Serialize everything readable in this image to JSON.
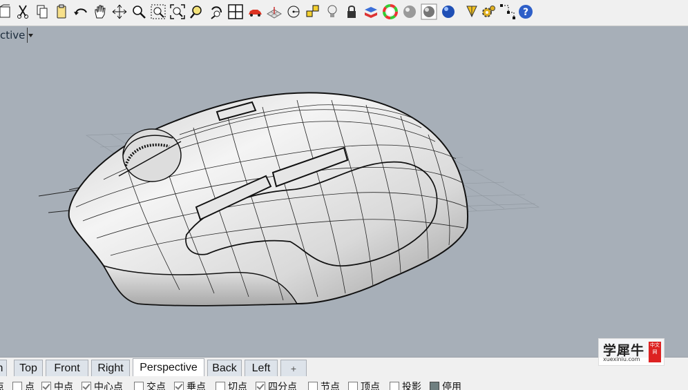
{
  "toolbar": {
    "icons": [
      "open-file-icon",
      "cut-icon",
      "copy-icon",
      "paste-icon",
      "undo-icon",
      "pan-hand-icon",
      "rotate-view-icon",
      "zoom-icon",
      "zoom-window-icon",
      "zoom-extents-icon",
      "zoom-selected-icon",
      "undo-view-icon",
      "four-viewports-icon",
      "car-icon",
      "grid-plane-icon",
      "circle-tool-icon",
      "point-snap-icon",
      "light-bulb-icon",
      "lock-icon",
      "layer-material-icon",
      "color-wheel-icon",
      "shaded-sphere-icon",
      "rendered-sphere-icon",
      "blue-sphere-icon",
      "select-pointer-icon",
      "settings-gear-icon",
      "grid-snap-icon",
      "help-icon"
    ]
  },
  "viewport": {
    "title": "ctive"
  },
  "tabs": [
    {
      "label": "n"
    },
    {
      "label": "Top"
    },
    {
      "label": "Front"
    },
    {
      "label": "Right"
    },
    {
      "label": "Perspective",
      "active": true
    },
    {
      "label": "Back"
    },
    {
      "label": "Left"
    },
    {
      "label": "+"
    }
  ],
  "osnap": [
    {
      "label": "点",
      "checked": false
    },
    {
      "label": "点",
      "checked": false
    },
    {
      "label": "中点",
      "checked": true
    },
    {
      "label": "中心点",
      "checked": true
    },
    {
      "label": "交点",
      "checked": false
    },
    {
      "label": "垂点",
      "checked": true
    },
    {
      "label": "切点",
      "checked": false
    },
    {
      "label": "四分点",
      "checked": true
    },
    {
      "label": "节点",
      "checked": false
    },
    {
      "label": "顶点",
      "checked": false
    },
    {
      "label": "投影",
      "checked": false
    },
    {
      "label": "停用",
      "checked": false,
      "disabled": true
    }
  ],
  "watermark": {
    "title": "学犀牛",
    "subtitle": "xuexiniu.com",
    "badge": "中文网"
  }
}
